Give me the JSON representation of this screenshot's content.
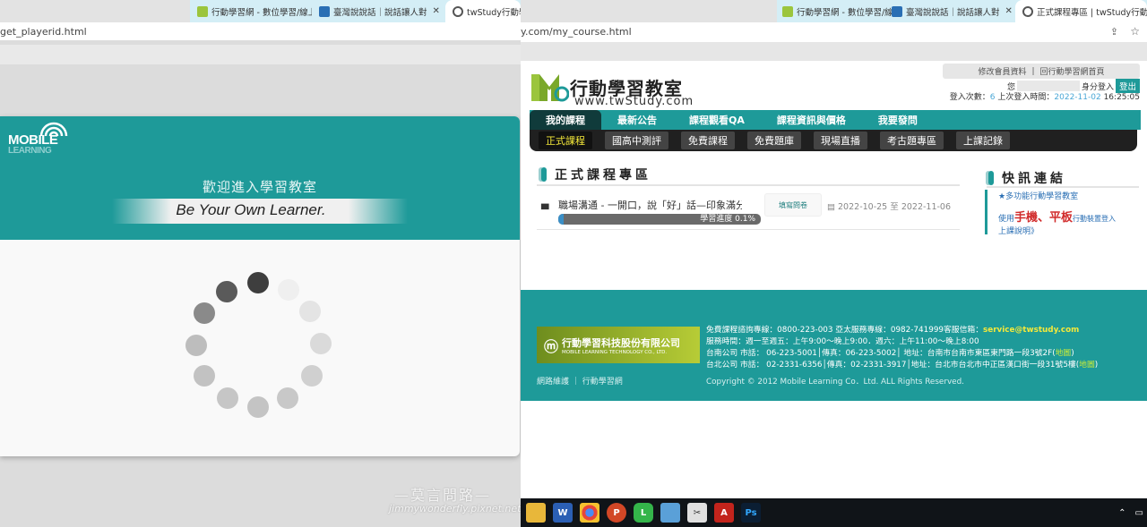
{
  "left": {
    "tabs": [
      {
        "label": "行動學習網 - 數位學習/線上",
        "close": "✕"
      },
      {
        "label": "臺灣說說話｜說話讓人對",
        "close": "✕"
      },
      {
        "label": "twStudy行動學",
        "close": ""
      }
    ],
    "address": "get_playerid.html",
    "logo_main": "MOBILE",
    "logo_sub": "LEARNING",
    "welcome": "歡迎進入學習教室",
    "slogan": "Be Your Own Learner."
  },
  "right": {
    "tabs": [
      {
        "label": "行動學習網 - 數位學習/線上",
        "close": "✕"
      },
      {
        "label": "臺灣說說話｜說話讓人對",
        "close": "✕"
      },
      {
        "label": "正式課程專區 | twStudy行動",
        "close": "✕"
      }
    ],
    "address": "y.com/my_course.html",
    "site": {
      "name": "行動學習教室",
      "url": "www.twStudy.com",
      "top_links": [
        "修改會員資料",
        "回行動學習網首頁"
      ],
      "user_prefix": "您",
      "user_suffix": "身分登入",
      "logout": "登出",
      "login_count_label": "登入次數：",
      "login_count": "6",
      "last_login_label": "上次登入時間：",
      "last_login_date": "2022-11-02",
      "last_login_time": "16:25:05"
    },
    "nav_main": [
      "我的課程",
      "最新公告",
      "課程觀看QA",
      "課程資訊與價格",
      "我要發問"
    ],
    "nav_sub": [
      "正式課程",
      "國高中測評",
      "免費課程",
      "免費題庫",
      "現場直播",
      "考古題專區",
      "上課記錄"
    ],
    "section_title": "正式課程專區",
    "course": {
      "name": "職場溝通 - 一開口，說「好」話—印象滿分",
      "fill_survey": "填寫問卷",
      "date_start": "2022-10-25",
      "date_sep": "至",
      "date_end": "2022-11-06",
      "progress_label": "學習進度",
      "progress_text": "0.1%",
      "progress_value": 0.1
    },
    "flash": {
      "title": "快訊連結",
      "item1": "★多功能行動學習教室",
      "item2_pre": "使用",
      "item2_highlight": "手機、平板",
      "item2_post": "行動裝置登入",
      "item2_end": "上課說明》"
    },
    "footer": {
      "company": "行動學習科技股份有限公司",
      "company_en": "MOBILE LEARNING TECHNOLOGY CO., LTD.",
      "links": [
        "網路維護",
        "行動學習網"
      ],
      "line1_pre": "免費課程諮詢專線：0800-223-003 亞太服務專線：0982-741999客服信箱：",
      "email": "service@twstudy.com",
      "line2": "服務時間：週一至週五：上午9:00～晚上9:00．週六：上午11:00～晚上8:00",
      "line3_pre": "台南公司 市話： 06-223-5001│傳真：06-223-5002│ 地址：台南市台南市東區東門路一段3號2F(",
      "line4_pre": "台北公司 市話： 02-2331-6356│傳真：02-2331-3917│地址：台北市台北市中正區漢口街一段31號5樓(",
      "map": "地圖",
      "close_paren": ")",
      "copyright": "Copyright © 2012 Mobile Learning Co．Ltd. ALL Rights Reserved."
    }
  },
  "watermark": {
    "title": "—莫言問路—",
    "sub": "jimmywonderfly.pixnet.net"
  },
  "colors": {
    "teal": "#1e9a99",
    "dark_nav": "#202020",
    "highlight": "#f5e93a"
  }
}
